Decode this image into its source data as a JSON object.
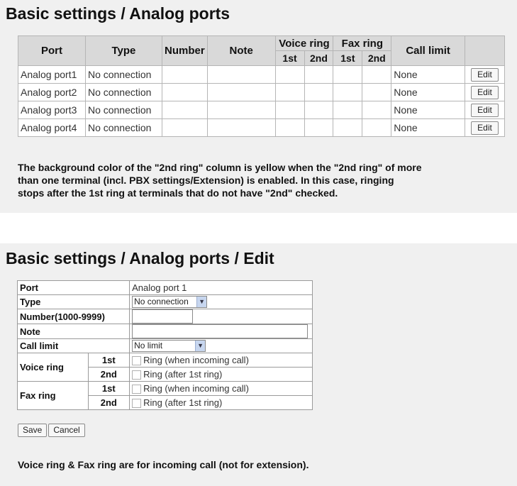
{
  "list": {
    "title": "Basic settings / Analog ports",
    "headers": {
      "port": "Port",
      "type": "Type",
      "number": "Number",
      "note": "Note",
      "voice_ring": "Voice ring",
      "fax_ring": "Fax ring",
      "first": "1st",
      "second": "2nd",
      "call_limit": "Call limit"
    },
    "rows": [
      {
        "port": "Analog port1",
        "type": "No connection",
        "number": "",
        "note": "",
        "call_limit": "None",
        "action": "Edit"
      },
      {
        "port": "Analog port2",
        "type": "No connection",
        "number": "",
        "note": "",
        "call_limit": "None",
        "action": "Edit"
      },
      {
        "port": "Analog port3",
        "type": "No connection",
        "number": "",
        "note": "",
        "call_limit": "None",
        "action": "Edit"
      },
      {
        "port": "Analog port4",
        "type": "No connection",
        "number": "",
        "note": "",
        "call_limit": "None",
        "action": "Edit"
      }
    ],
    "note_lines": [
      "The background color of the \"2nd ring\" column is yellow when the \"2nd ring\" of more",
      "than one terminal (incl. PBX settings/Extension) is enabled. In this case, ringing",
      "stops after the 1st ring at terminals that do not have \"2nd\" checked."
    ]
  },
  "edit": {
    "title": "Basic settings / Analog ports / Edit",
    "port_label": "Port",
    "port_value": "Analog port 1",
    "type_label": "Type",
    "type_value": "No connection",
    "number_label": "Number(1000-9999)",
    "number_value": "",
    "note_label": "Note",
    "note_value": "",
    "call_limit_label": "Call limit",
    "call_limit_value": "No limit",
    "voice_ring_label": "Voice ring",
    "fax_ring_label": "Fax ring",
    "first_label": "1st",
    "second_label": "2nd",
    "ring_incoming_label": "Ring (when incoming call)",
    "ring_after_label": "Ring (after 1st ring)",
    "save_label": "Save",
    "cancel_label": "Cancel",
    "footer_note": "Voice ring & Fax ring are for incoming call (not for extension)."
  },
  "icons": {
    "dropdown": "chevron-down-icon",
    "checkbox": "checkbox-unchecked"
  }
}
